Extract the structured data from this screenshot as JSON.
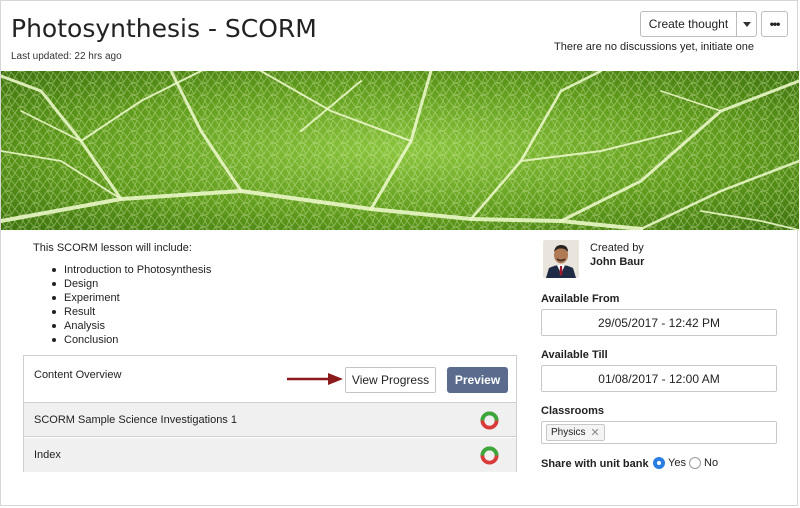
{
  "header": {
    "title": "Photosynthesis - SCORM",
    "last_updated": "Last updated: 22 hrs ago",
    "create_thought_label": "Create thought",
    "more_label": "•••",
    "discussion_hint": "There are no discussions yet, initiate one"
  },
  "lesson": {
    "intro": "This SCORM lesson will include:",
    "items": [
      {
        "label": "Introduction to Photosynthesis"
      },
      {
        "label": "Design"
      },
      {
        "label": "Experiment"
      },
      {
        "label": "Result"
      },
      {
        "label": "Analysis"
      },
      {
        "label": "Conclusion"
      }
    ]
  },
  "content_overview": {
    "title": "Content Overview",
    "view_progress_label": "View Progress",
    "preview_label": "Preview",
    "rows": [
      {
        "label": "SCORM Sample Science Investigations 1"
      },
      {
        "label": "Index"
      }
    ]
  },
  "sidebar": {
    "created_by_label": "Created by",
    "author": "John Baur",
    "available_from_label": "Available From",
    "available_from": "29/05/2017 - 12:42 PM",
    "available_till_label": "Available Till",
    "available_till": "01/08/2017 - 12:00 AM",
    "classrooms_label": "Classrooms",
    "classroom_tag": "Physics",
    "share_label": "Share with unit bank",
    "share_yes": "Yes",
    "share_no": "No",
    "share_selected": "Yes"
  },
  "colors": {
    "preview_button": "#5a6b8d",
    "accent_blue": "#2a7de1",
    "progress_green": "#3aa83a",
    "progress_red": "#d93a3a",
    "arrow": "#8b1a1a",
    "leaf_green": "#5f9a1c"
  },
  "icons": {
    "caret": "chevron-down-icon",
    "more": "ellipsis-icon",
    "remove_tag": "close-icon",
    "progress": "progress-ring-icon",
    "arrow": "arrow-right-icon"
  }
}
